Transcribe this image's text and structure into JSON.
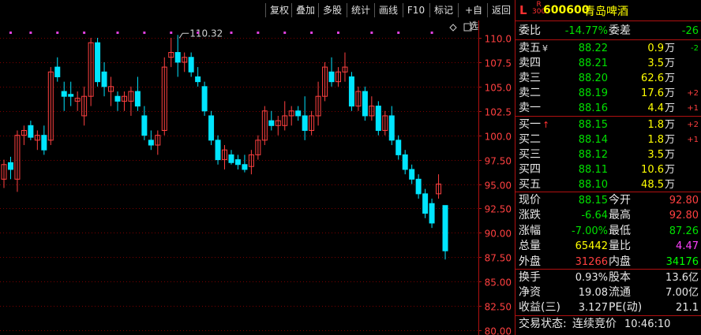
{
  "toolbar": {
    "items": [
      "复权",
      "叠加",
      "多股",
      "统计",
      "画线",
      "F10",
      "标记",
      "+自选",
      "返回"
    ]
  },
  "stock": {
    "market_flag": "L",
    "index_tag_top": "R",
    "index_tag_bottom": "300",
    "code": "600600",
    "name": "青岛啤酒"
  },
  "colors": {
    "up": "#ff4040",
    "down": "#00e5ff",
    "falling_text": "#00e000",
    "accent": "#ffff00",
    "border": "#b01010",
    "marker": "#e040e0"
  },
  "summary": {
    "wei_bi_label": "委比",
    "wei_bi": "-14.77%",
    "wei_cha_label": "委差",
    "wei_cha": "-26"
  },
  "sell_orders": [
    {
      "label": "卖五",
      "mark": "¥",
      "price": "88.22",
      "volume": "0.9",
      "unit": "万",
      "change": "-2"
    },
    {
      "label": "卖四",
      "mark": "",
      "price": "88.21",
      "volume": "3.5",
      "unit": "万",
      "change": ""
    },
    {
      "label": "卖三",
      "mark": "",
      "price": "88.20",
      "volume": "62.6",
      "unit": "万",
      "change": ""
    },
    {
      "label": "卖二",
      "mark": "",
      "price": "88.19",
      "volume": "17.6",
      "unit": "万",
      "change": "+2"
    },
    {
      "label": "卖一",
      "mark": "",
      "price": "88.16",
      "volume": "4.4",
      "unit": "万",
      "change": "+1"
    }
  ],
  "buy_orders": [
    {
      "label": "买一",
      "mark": "↑",
      "price": "88.15",
      "volume": "1.8",
      "unit": "万",
      "change": "+2"
    },
    {
      "label": "买二",
      "mark": "",
      "price": "88.14",
      "volume": "1.8",
      "unit": "万",
      "change": "+1"
    },
    {
      "label": "买三",
      "mark": "",
      "price": "88.12",
      "volume": "3.5",
      "unit": "万",
      "change": ""
    },
    {
      "label": "买四",
      "mark": "",
      "price": "88.11",
      "volume": "10.6",
      "unit": "万",
      "change": ""
    },
    {
      "label": "买五",
      "mark": "",
      "price": "88.10",
      "volume": "48.5",
      "unit": "万",
      "change": ""
    }
  ],
  "quote": [
    {
      "l1": "现价",
      "v1": "88.15",
      "c1": "down",
      "l2": "今开",
      "v2": "92.80",
      "c2": "up"
    },
    {
      "l1": "涨跌",
      "v1": "-6.64",
      "c1": "down",
      "l2": "最高",
      "v2": "92.80",
      "c2": "up"
    },
    {
      "l1": "涨幅",
      "v1": "-7.00%",
      "c1": "down",
      "l2": "最低",
      "v2": "87.26",
      "c2": "down"
    },
    {
      "l1": "总量",
      "v1": "65442",
      "c1": "yel",
      "l2": "量比",
      "v2": "4.47",
      "c2": "mag"
    },
    {
      "l1": "外盘",
      "v1": "31266",
      "c1": "up",
      "l2": "内盘",
      "v2": "34176",
      "c2": "grn"
    }
  ],
  "fundamentals": [
    {
      "l1": "换手",
      "v1": "0.93%",
      "l2": "股本",
      "v2": "13.6亿"
    },
    {
      "l1": "净资",
      "v1": "19.08",
      "l2": "流通",
      "v2": "7.00亿"
    },
    {
      "l1": "收益(三)",
      "v1": "3.127",
      "l2": "PE(动)",
      "v2": "21.1"
    }
  ],
  "status": {
    "label": "交易状态:",
    "state": "连续竞价",
    "time": "10:46:10"
  },
  "chart_data": {
    "type": "candlestick",
    "ylim": [
      80,
      111.5
    ],
    "y_ticks": [
      "80.00",
      "82.50",
      "85.00",
      "87.50",
      "90.00",
      "92.50",
      "95.00",
      "97.50",
      "100.0",
      "102.5",
      "105.0",
      "107.5",
      "110.0"
    ],
    "max_label": "110.32",
    "candles": [
      {
        "o": 95.5,
        "h": 97.5,
        "l": 94.6,
        "c": 97.0
      },
      {
        "o": 97.2,
        "h": 97.8,
        "l": 95.5,
        "c": 96.5
      },
      {
        "o": 95.5,
        "h": 100.5,
        "l": 94.2,
        "c": 100.0
      },
      {
        "o": 100.0,
        "h": 101.0,
        "l": 99.0,
        "c": 100.5
      },
      {
        "o": 101.0,
        "h": 101.5,
        "l": 99.5,
        "c": 99.8
      },
      {
        "o": 99.5,
        "h": 100.5,
        "l": 98.5,
        "c": 100.0
      },
      {
        "o": 100.0,
        "h": 101.0,
        "l": 98.0,
        "c": 98.5
      },
      {
        "o": 99.5,
        "h": 107.0,
        "l": 99.0,
        "c": 106.5
      },
      {
        "o": 107.0,
        "h": 108.0,
        "l": 105.5,
        "c": 106.0
      },
      {
        "o": 104.5,
        "h": 105.5,
        "l": 102.5,
        "c": 104.0
      },
      {
        "o": 104.2,
        "h": 105.5,
        "l": 103.0,
        "c": 104.0
      },
      {
        "o": 103.5,
        "h": 104.5,
        "l": 102.5,
        "c": 103.8
      },
      {
        "o": 102.0,
        "h": 105.0,
        "l": 101.0,
        "c": 104.0
      },
      {
        "o": 104.0,
        "h": 110.0,
        "l": 103.0,
        "c": 109.5
      },
      {
        "o": 109.5,
        "h": 110.0,
        "l": 105.0,
        "c": 105.5
      },
      {
        "o": 106.5,
        "h": 107.5,
        "l": 104.0,
        "c": 105.0
      },
      {
        "o": 104.5,
        "h": 106.0,
        "l": 103.0,
        "c": 105.0
      },
      {
        "o": 104.0,
        "h": 104.5,
        "l": 102.5,
        "c": 103.5
      },
      {
        "o": 103.5,
        "h": 104.5,
        "l": 102.5,
        "c": 104.0
      },
      {
        "o": 103.5,
        "h": 105.0,
        "l": 102.0,
        "c": 104.5
      },
      {
        "o": 104.5,
        "h": 106.0,
        "l": 102.5,
        "c": 103.0
      },
      {
        "o": 102.0,
        "h": 103.0,
        "l": 99.5,
        "c": 100.0
      },
      {
        "o": 99.5,
        "h": 100.5,
        "l": 98.5,
        "c": 99.0
      },
      {
        "o": 99.0,
        "h": 100.5,
        "l": 98.0,
        "c": 100.0
      },
      {
        "o": 100.5,
        "h": 108.0,
        "l": 100.0,
        "c": 107.0
      },
      {
        "o": 108.0,
        "h": 110.0,
        "l": 107.0,
        "c": 108.5
      },
      {
        "o": 108.5,
        "h": 110.3,
        "l": 106.0,
        "c": 107.5
      },
      {
        "o": 107.5,
        "h": 108.5,
        "l": 106.5,
        "c": 108.0
      },
      {
        "o": 108.0,
        "h": 108.5,
        "l": 106.0,
        "c": 106.5
      },
      {
        "o": 106.0,
        "h": 107.0,
        "l": 105.0,
        "c": 105.5
      },
      {
        "o": 105.0,
        "h": 105.5,
        "l": 102.0,
        "c": 102.5
      },
      {
        "o": 102.0,
        "h": 102.5,
        "l": 99.0,
        "c": 99.5
      },
      {
        "o": 99.5,
        "h": 100.0,
        "l": 97.0,
        "c": 97.5
      },
      {
        "o": 97.5,
        "h": 99.0,
        "l": 96.5,
        "c": 98.5
      },
      {
        "o": 98.0,
        "h": 98.5,
        "l": 97.0,
        "c": 97.2
      },
      {
        "o": 97.5,
        "h": 98.0,
        "l": 96.5,
        "c": 97.0
      },
      {
        "o": 97.0,
        "h": 98.0,
        "l": 96.2,
        "c": 96.5
      },
      {
        "o": 96.8,
        "h": 98.5,
        "l": 96.0,
        "c": 98.0
      },
      {
        "o": 98.0,
        "h": 100.0,
        "l": 97.5,
        "c": 99.5
      },
      {
        "o": 99.5,
        "h": 103.0,
        "l": 99.0,
        "c": 102.5
      },
      {
        "o": 101.5,
        "h": 102.5,
        "l": 100.5,
        "c": 101.0
      },
      {
        "o": 101.0,
        "h": 102.0,
        "l": 100.0,
        "c": 101.5
      },
      {
        "o": 101.0,
        "h": 103.5,
        "l": 100.5,
        "c": 102.0
      },
      {
        "o": 102.0,
        "h": 103.0,
        "l": 101.0,
        "c": 102.5
      },
      {
        "o": 102.5,
        "h": 103.0,
        "l": 101.5,
        "c": 102.0
      },
      {
        "o": 102.0,
        "h": 104.0,
        "l": 99.5,
        "c": 100.5
      },
      {
        "o": 100.5,
        "h": 102.5,
        "l": 100.0,
        "c": 102.0
      },
      {
        "o": 102.0,
        "h": 105.5,
        "l": 101.0,
        "c": 104.0
      },
      {
        "o": 104.0,
        "h": 107.5,
        "l": 103.5,
        "c": 107.0
      },
      {
        "o": 106.5,
        "h": 108.0,
        "l": 105.0,
        "c": 105.5
      },
      {
        "o": 105.5,
        "h": 107.0,
        "l": 105.0,
        "c": 106.5
      },
      {
        "o": 106.5,
        "h": 108.5,
        "l": 105.5,
        "c": 107.0
      },
      {
        "o": 106.0,
        "h": 106.5,
        "l": 102.5,
        "c": 103.0
      },
      {
        "o": 103.0,
        "h": 105.0,
        "l": 102.5,
        "c": 104.5
      },
      {
        "o": 104.5,
        "h": 105.0,
        "l": 101.5,
        "c": 102.0
      },
      {
        "o": 102.0,
        "h": 104.0,
        "l": 101.5,
        "c": 103.0
      },
      {
        "o": 103.0,
        "h": 103.5,
        "l": 100.0,
        "c": 100.5
      },
      {
        "o": 100.5,
        "h": 102.5,
        "l": 100.0,
        "c": 102.0
      },
      {
        "o": 102.0,
        "h": 103.0,
        "l": 99.0,
        "c": 99.5
      },
      {
        "o": 99.5,
        "h": 100.0,
        "l": 97.5,
        "c": 98.0
      },
      {
        "o": 98.0,
        "h": 98.5,
        "l": 96.0,
        "c": 96.5
      },
      {
        "o": 96.5,
        "h": 97.0,
        "l": 95.0,
        "c": 95.5
      },
      {
        "o": 95.5,
        "h": 96.0,
        "l": 93.5,
        "c": 94.0
      },
      {
        "o": 94.0,
        "h": 94.5,
        "l": 91.5,
        "c": 92.0
      },
      {
        "o": 93.0,
        "h": 93.5,
        "l": 90.5,
        "c": 91.0
      },
      {
        "o": 94.0,
        "h": 96.0,
        "l": 93.5,
        "c": 95.0
      },
      {
        "o": 92.8,
        "h": 92.8,
        "l": 87.26,
        "c": 88.15
      }
    ],
    "marker_indices": [
      1,
      4,
      8,
      12,
      17,
      21,
      25,
      29,
      34,
      38,
      42,
      46,
      50,
      55,
      59,
      64
    ]
  }
}
